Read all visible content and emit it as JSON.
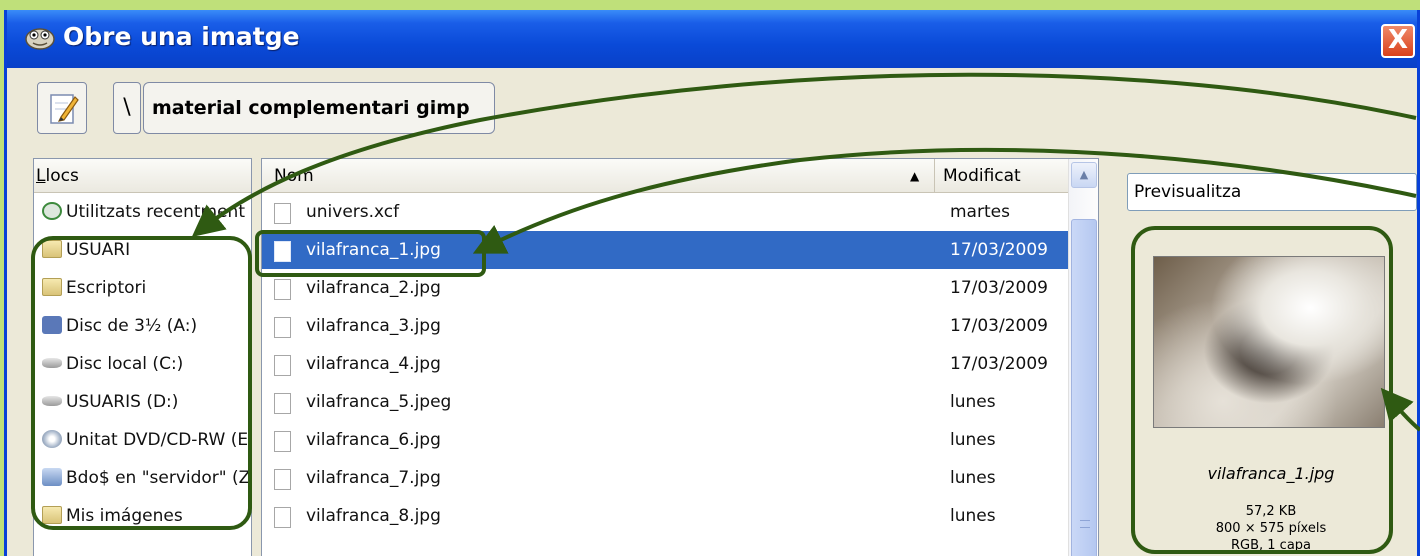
{
  "window": {
    "title": "Obre una imatge",
    "close_label": "X"
  },
  "toolbar": {
    "separator_label": "\\",
    "folder_label": "material complementari gimp"
  },
  "places": {
    "header": "Llocs",
    "items": [
      {
        "label": "Utilitzats recentment",
        "icon": "recent-icon"
      },
      {
        "label": "USUARI",
        "icon": "folder-icon"
      },
      {
        "label": "Escriptori",
        "icon": "folder-icon"
      },
      {
        "label": "Disc de 3½ (A:)",
        "icon": "floppy-icon"
      },
      {
        "label": "Disc local (C:)",
        "icon": "drive-icon"
      },
      {
        "label": "USUARIS (D:)",
        "icon": "drive-icon"
      },
      {
        "label": "Unitat DVD/CD-RW (E:)",
        "icon": "dvd-icon"
      },
      {
        "label": "Bdo$ en \"servidor\" (Z:)",
        "icon": "network-drive-icon"
      },
      {
        "label": "Mis imágenes",
        "icon": "folder-icon"
      }
    ]
  },
  "files": {
    "header_name": "Nom",
    "header_modified": "Modificat",
    "sort_indicator": "▲",
    "rows": [
      {
        "name": "univers.xcf",
        "modified": "martes",
        "selected": false
      },
      {
        "name": "vilafranca_1.jpg",
        "modified": "17/03/2009",
        "selected": true
      },
      {
        "name": "vilafranca_2.jpg",
        "modified": "17/03/2009",
        "selected": false
      },
      {
        "name": "vilafranca_3.jpg",
        "modified": "17/03/2009",
        "selected": false
      },
      {
        "name": "vilafranca_4.jpg",
        "modified": "17/03/2009",
        "selected": false
      },
      {
        "name": "vilafranca_5.jpeg",
        "modified": "lunes",
        "selected": false
      },
      {
        "name": "vilafranca_6.jpg",
        "modified": "lunes",
        "selected": false
      },
      {
        "name": "vilafranca_7.jpg",
        "modified": "lunes",
        "selected": false
      },
      {
        "name": "vilafranca_8.jpg",
        "modified": "lunes",
        "selected": false
      }
    ]
  },
  "preview": {
    "button_label": "Previsualitza",
    "filename": "vilafranca_1.jpg",
    "size": "57,2 KB",
    "dimensions": "800 × 575 píxels",
    "mode": "RGB, 1 capa"
  },
  "colors": {
    "titlebar": "#0a4ad8",
    "selection": "#316ac5",
    "annotation": "#2f5a12",
    "background": "#bfe07a"
  }
}
